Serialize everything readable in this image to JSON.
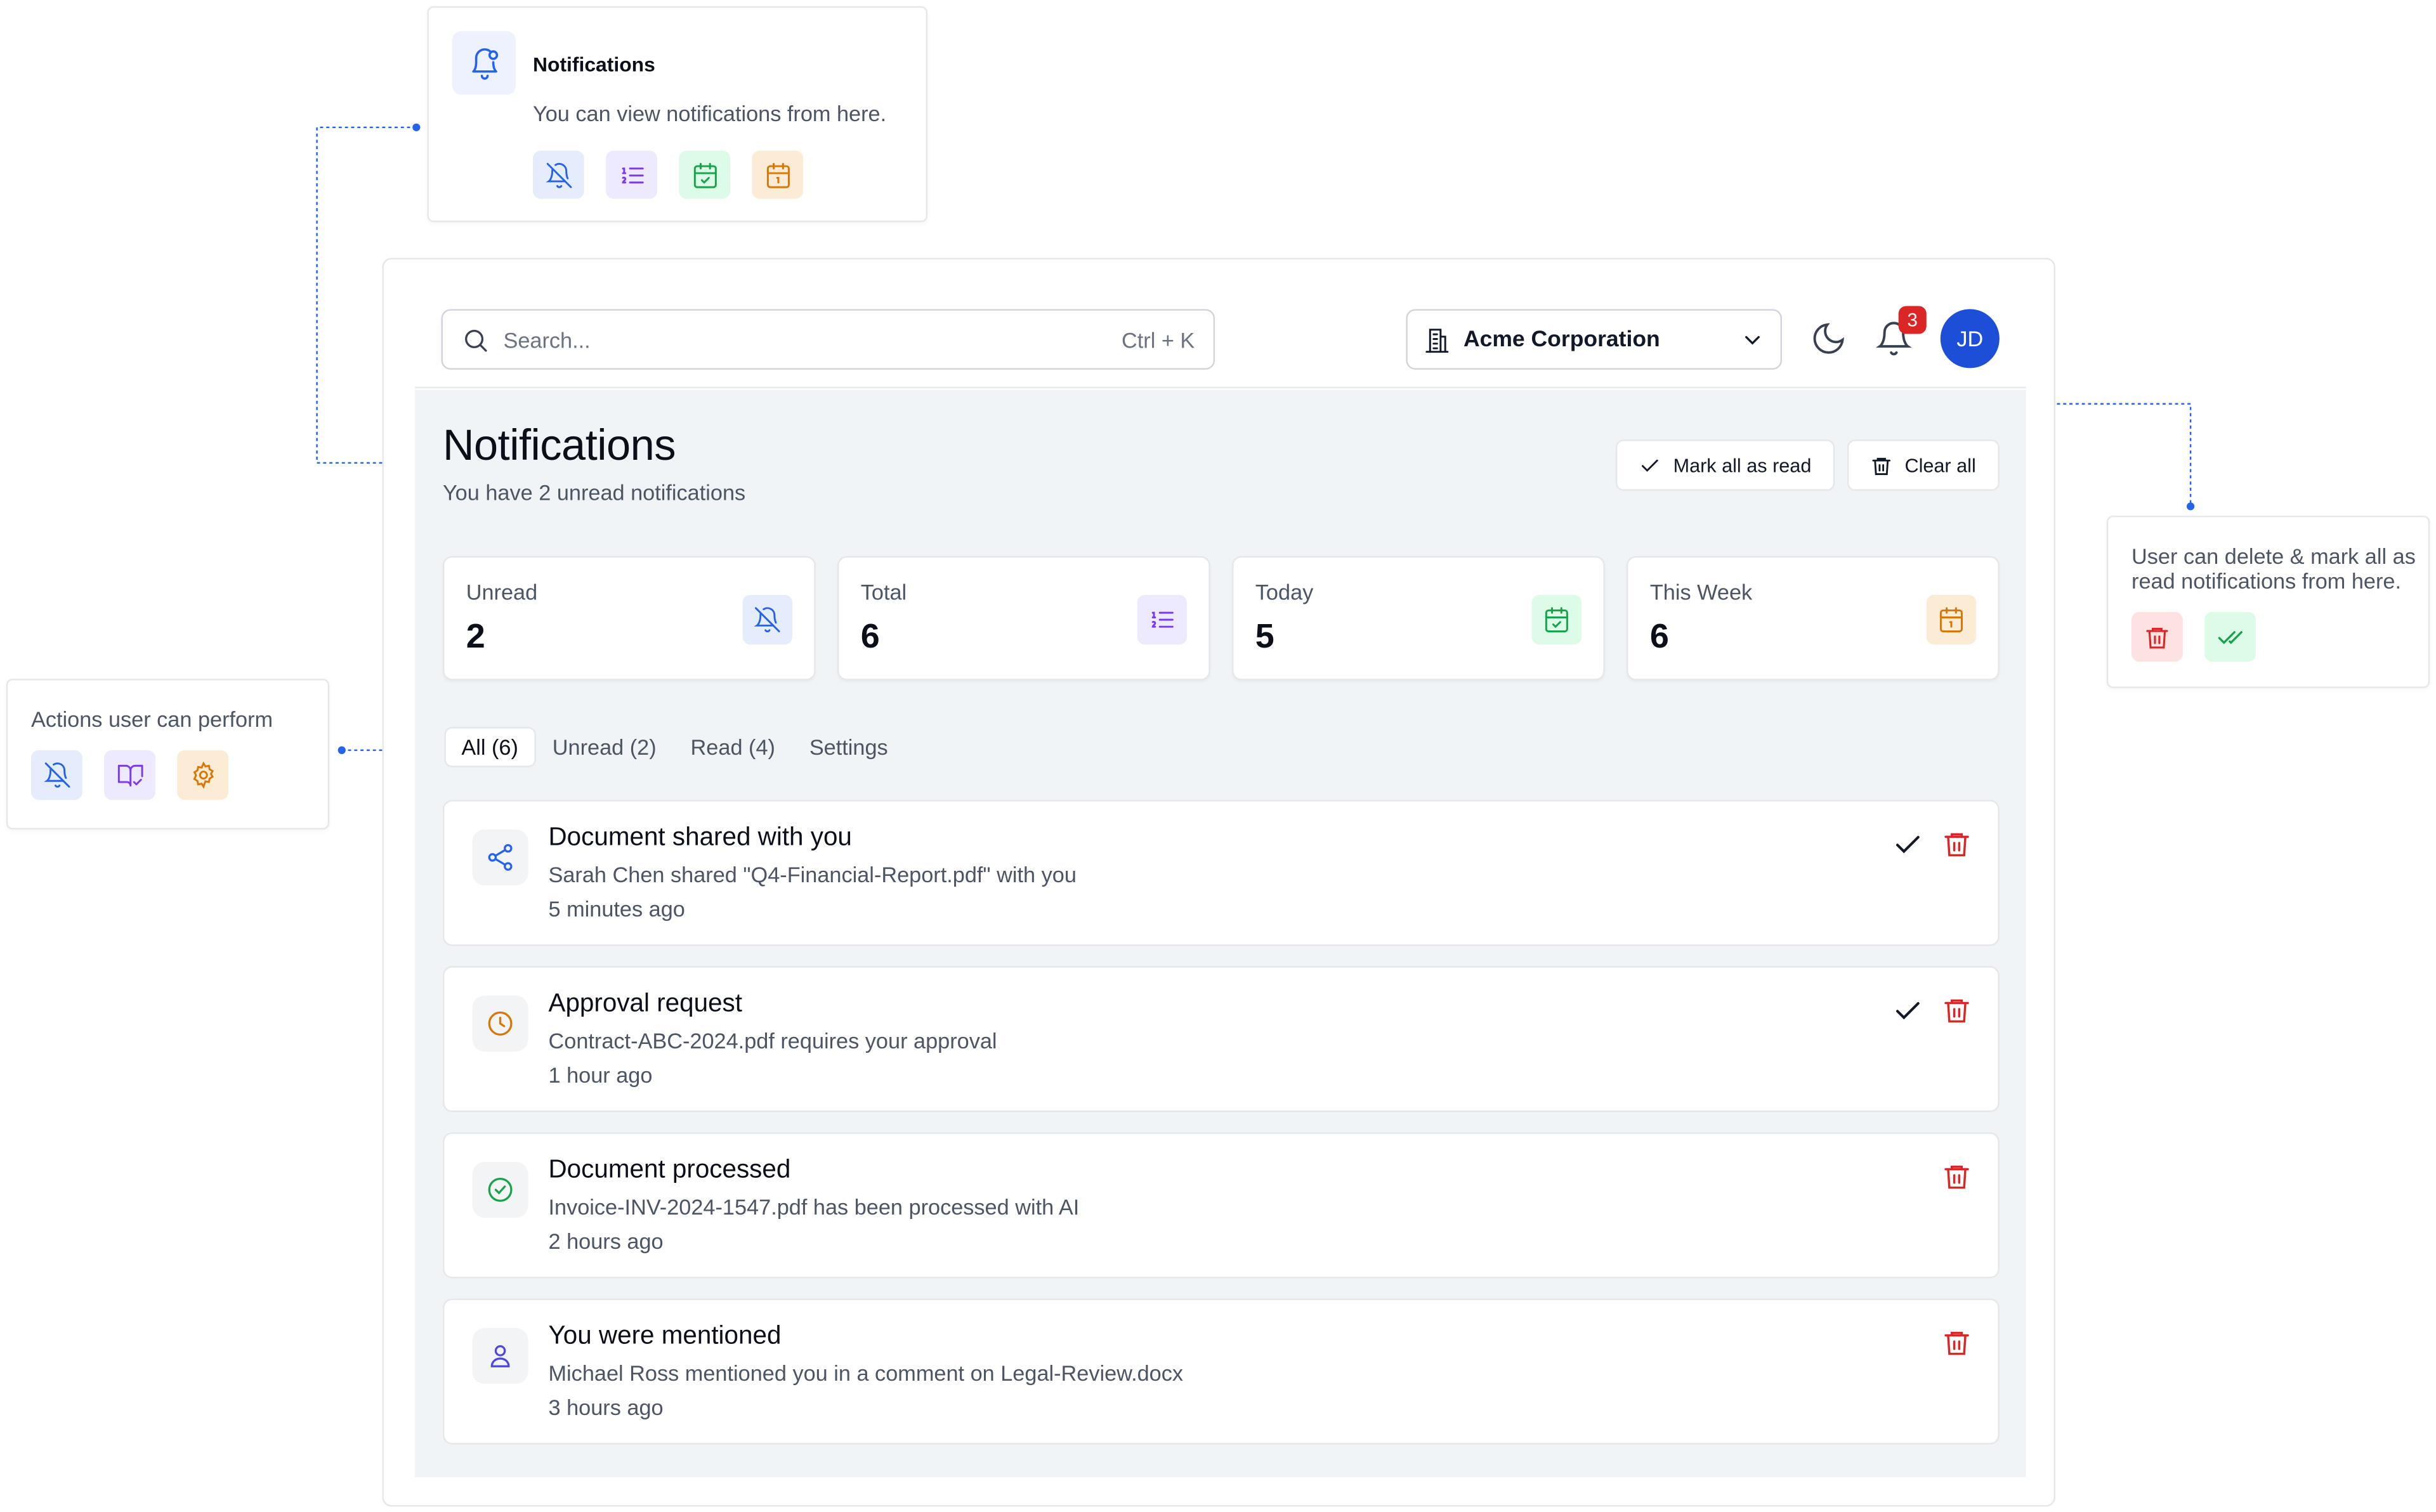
{
  "colors": {
    "accent": "#2563eb",
    "danger": "#dc2626",
    "success": "#16a34a",
    "purple": "#7c3aed",
    "amber": "#d97706"
  },
  "callout_notifications": {
    "title": "Notifications",
    "text": "You can view notifications from here.",
    "icons": [
      "bell-off-icon",
      "list-ordered-icon",
      "calendar-check-icon",
      "calendar-day-icon"
    ]
  },
  "callout_actions": {
    "text": "Actions user can perform",
    "icons": [
      "bell-off-icon",
      "book-check-icon",
      "gear-icon"
    ]
  },
  "callout_delete": {
    "text": "User can delete & mark all as read notifications from here.",
    "icons": [
      "trash-icon",
      "double-check-icon"
    ]
  },
  "topbar": {
    "search_placeholder": "Search...",
    "search_shortcut": "Ctrl + K",
    "org_name": "Acme Corporation",
    "notification_count": "3",
    "avatar_initials": "JD"
  },
  "page": {
    "title": "Notifications",
    "subtitle": "You have 2 unread notifications",
    "mark_all_label": "Mark all as read",
    "clear_all_label": "Clear all"
  },
  "stats": [
    {
      "label": "Unread",
      "value": "2",
      "icon": "bell-off-icon"
    },
    {
      "label": "Total",
      "value": "6",
      "icon": "list-ordered-icon"
    },
    {
      "label": "Today",
      "value": "5",
      "icon": "calendar-check-icon"
    },
    {
      "label": "This Week",
      "value": "6",
      "icon": "calendar-day-icon"
    }
  ],
  "tabs": [
    {
      "label": "All (6)",
      "active": true
    },
    {
      "label": "Unread (2)"
    },
    {
      "label": "Read (4)"
    },
    {
      "label": "Settings"
    }
  ],
  "notifications": [
    {
      "title": "Document shared with you",
      "description": "Sarah Chen shared \"Q4-Financial-Report.pdf\" with you",
      "time": "5 minutes ago",
      "icon": "share-icon",
      "unread": true
    },
    {
      "title": "Approval request",
      "description": "Contract-ABC-2024.pdf requires your approval",
      "time": "1 hour ago",
      "icon": "clock-icon",
      "unread": true
    },
    {
      "title": "Document processed",
      "description": "Invoice-INV-2024-1547.pdf has been processed with AI",
      "time": "2 hours ago",
      "icon": "check-circle-icon",
      "unread": false
    },
    {
      "title": "You were mentioned",
      "description": "Michael Ross mentioned you in a comment on Legal-Review.docx",
      "time": "3 hours ago",
      "icon": "user-icon",
      "unread": false
    }
  ]
}
